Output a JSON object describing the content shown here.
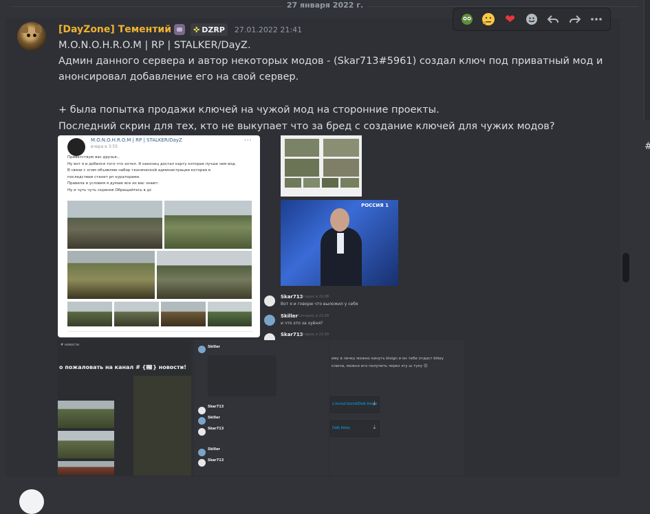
{
  "date_divider": "27 января 2022 г.",
  "message": {
    "username": "[DayZone] Тементий",
    "server_tag": "DZRP",
    "timestamp": "27.01.2022 21:41",
    "lines": [
      "M.O.N.O.H.R.O.M | RP | STALKER/DayZ.",
      "Админ данного сервера и автор некоторых модов - (Skar713#5961)  создал ключ под приватный мод и",
      "анонсировал добавление его на свой сервер.",
      "",
      "+ была попытка продажи ключей на чужой мод на сторонние проекты.",
      "Последний скрин для тех, кто не выкупает что за бред с создание ключей для чужих модов?"
    ]
  },
  "toolbar": {
    "reactions": [
      "nerd-emoji",
      "thinking-emoji",
      "heart-emoji"
    ],
    "actions": [
      "add-reaction",
      "reply",
      "forward",
      "more"
    ]
  },
  "attachments": {
    "vk_post": {
      "author": "M.O.N.O.H.R.O.M | RP | STALKER/DayZ",
      "time": "вчера в 3:55",
      "text": "Приветствую вас друзья...\nНу вот я и добился того что хотел. Я наконец достал карту которая лучше чем вод.\nВ связи с этим объявляю набор технической администрации которая в\nпоследствии станет рп кураторами.\nПравила и условия я думаю все из вас знают.\nНу и чуть чуть скринов Обращайтесь в дс"
    },
    "tv_logo": "РОССИЯ 1",
    "chat_crop": {
      "rows": [
        {
          "name": "Skar713",
          "time": "Сегодня, в 21:08",
          "text": "Вот я и говорю что выложил у себя"
        },
        {
          "name": "Skiller",
          "time": "Сегодня, в 21:09",
          "text": "и что это за хуйня?"
        },
        {
          "name": "Skar713",
          "time": "Сегодня, в 21:09",
          "text": ""
        }
      ]
    },
    "channel_crop": {
      "header": "# новости",
      "welcome": "о пожаловать на канал # {📰} новости!"
    },
    "dm_crop": {
      "names": [
        "Skiller",
        "Skar713",
        "Skiller",
        "Skar713",
        "Skiller",
        "Skar713"
      ]
    },
    "dm_crop2": {
      "line1": "ему в личку можно кинуть bisign и он тебе отдаст bikey",
      "line2": "ключа, можно его получить через эту ш тукy 😊",
      "file1": "s.Includ.Gorod/Dalk.bisign",
      "file2": "Dalk.bikey"
    }
  }
}
